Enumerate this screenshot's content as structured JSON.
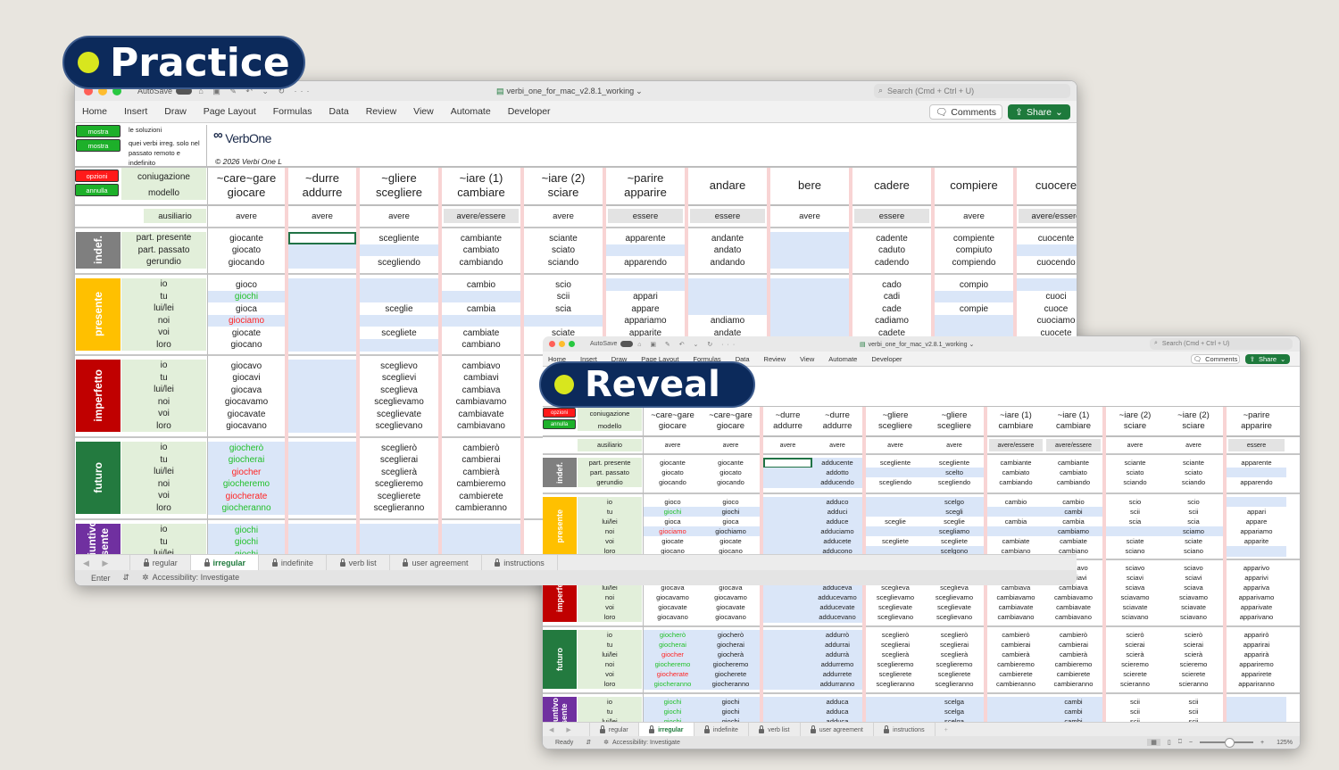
{
  "colors": {
    "input": "#dae6f8",
    "label_bg": "#e2efda",
    "separator": "#f8d4d4",
    "aux_gray": "#e3e3e3",
    "correct": "#22c02a",
    "wrong": "#ff2424",
    "badge": "#0c2a5b",
    "badge_dot": "#d8e61e",
    "excel_green": "#1e7a3c"
  },
  "badges": {
    "practice": "Practice",
    "reveal": "Reveal"
  },
  "app": {
    "autosave": "AutoSave",
    "file_title": "verbi_one_for_mac_v2.8.1_working",
    "search_placeholder": "Search (Cmd + Ctrl + U)",
    "ribbon_tabs": [
      "Home",
      "Insert",
      "Draw",
      "Page Layout",
      "Formulas",
      "Data",
      "Review",
      "View",
      "Automate",
      "Developer"
    ],
    "comments": "Comments",
    "share": "Share",
    "sheet_tabs": [
      {
        "label": "regular",
        "active": false
      },
      {
        "label": "irregular",
        "active": true
      },
      {
        "label": "indefinite",
        "active": false
      },
      {
        "label": "verb list",
        "active": false
      },
      {
        "label": "user agreement",
        "active": false
      },
      {
        "label": "instructions",
        "active": false
      }
    ],
    "add_sheet": "+",
    "accessibility": "Accessibility: Investigate",
    "zoom_level": "125%"
  },
  "practice_status": "Enter",
  "reveal_status": "Ready",
  "controls": {
    "mostra_1": "mostra",
    "mostra_1_label": "le soluzioni",
    "mostra_2": "mostra",
    "mostra_2_label": "quei verbi irreg. solo nel passato remoto e indefinito",
    "logo": "VerbOne",
    "copyright": "© 2026 Verbi One L",
    "opzioni": "opzioni",
    "annulla": "annulla",
    "coniugazione": "coniugazione",
    "modello": "modello",
    "ausiliario": "ausiliario"
  },
  "tenses": [
    {
      "key": "indef",
      "name": "indef.",
      "color": "#7f7f7f"
    },
    {
      "key": "pres",
      "name": "presente",
      "color": "#ffc000"
    },
    {
      "key": "imp",
      "name": "imperfetto",
      "color": "#c00000"
    },
    {
      "key": "fut",
      "name": "futuro",
      "color": "#237a3f"
    },
    {
      "key": "cong",
      "name": "congiuntivo presente",
      "color": "#7030a0"
    }
  ],
  "row_labels": {
    "indef": [
      "part. presente",
      "part. passato",
      "gerundio"
    ],
    "persons": [
      "io",
      "tu",
      "lui/lei",
      "noi",
      "voi",
      "loro"
    ]
  },
  "practice_columns": [
    {
      "h": [
        "~care~gare",
        "giocare"
      ],
      "aux": "avere",
      "indef": [
        "giocante",
        "giocato",
        "giocando"
      ],
      "pres": [
        "gioco",
        {
          "v": "giochi",
          "s": "ok"
        },
        "gioca",
        {
          "v": "giociamo",
          "s": "bad"
        },
        "giocate",
        "giocano"
      ],
      "imp": [
        "giocavo",
        "giocavi",
        "giocava",
        "giocavamo",
        "giocavate",
        "giocavano"
      ],
      "fut": [
        {
          "v": "giocherò",
          "s": "ok"
        },
        {
          "v": "giocherai",
          "s": "ok"
        },
        {
          "v": "giocher",
          "s": "bad"
        },
        {
          "v": "giocheremo",
          "s": "ok"
        },
        {
          "v": "giocherate",
          "s": "bad"
        },
        {
          "v": "giocheranno",
          "s": "ok"
        }
      ],
      "cong": [
        {
          "v": "giochi",
          "s": "ok"
        },
        {
          "v": "giochi",
          "s": "ok"
        },
        {
          "v": "giochi",
          "s": "ok"
        }
      ]
    },
    {
      "h": [
        "~durre",
        "addurre"
      ],
      "aux": "avere",
      "indef": [
        {
          "s": "sel"
        },
        null,
        null
      ],
      "pres": [
        null,
        null,
        null,
        null,
        null,
        null
      ],
      "imp": [
        null,
        null,
        null,
        null,
        null,
        null
      ],
      "fut": [
        null,
        null,
        null,
        null,
        null,
        null
      ],
      "cong": [
        null,
        null,
        null
      ]
    },
    {
      "h": [
        "~gliere",
        "scegliere"
      ],
      "aux": "avere",
      "indef": [
        "scegliente",
        null,
        "scegliendo"
      ],
      "pres": [
        null,
        null,
        "sceglie",
        null,
        "scegliete",
        null
      ],
      "imp": [
        "sceglievo",
        "sceglievi",
        "sceglieva",
        "sceglievamo",
        "sceglievate",
        "sceglievano"
      ],
      "fut": [
        "sceglierò",
        "sceglierai",
        "sceglierà",
        "sceglieremo",
        "sceglierete",
        "sceglieranno"
      ],
      "cong": [
        null,
        null,
        null
      ]
    },
    {
      "h": [
        "~iare (1)",
        "cambiare"
      ],
      "aux": "avere/essere",
      "aux_gray": true,
      "indef": [
        "cambiante",
        "cambiato",
        "cambiando"
      ],
      "pres": [
        "cambio",
        null,
        "cambia",
        null,
        "cambiate",
        "cambiano"
      ],
      "imp": [
        "cambiavo",
        "cambiavi",
        "cambiava",
        "cambiavamo",
        "cambiavate",
        "cambiavano"
      ],
      "fut": [
        "cambierò",
        "cambierai",
        "cambierà",
        "cambieremo",
        "cambierete",
        "cambieranno"
      ],
      "cong": [
        null,
        null,
        null
      ]
    },
    {
      "h": [
        "~iare (2)",
        "sciare"
      ],
      "aux": "avere",
      "indef": [
        "sciante",
        "sciato",
        "sciando"
      ],
      "pres": [
        "scio",
        "scii",
        "scia",
        null,
        "sciate"
      ]
    },
    {
      "h": [
        "~parire",
        "apparire"
      ],
      "aux": "essere",
      "aux_gray": true,
      "indef": [
        "apparente",
        null,
        "apparendo"
      ],
      "pres": [
        null,
        "appari",
        "appare",
        "appariamo",
        "apparite"
      ]
    },
    {
      "h": [
        "",
        "andare"
      ],
      "aux": "essere",
      "aux_gray": true,
      "indef": [
        "andante",
        "andato",
        "andando"
      ],
      "pres": [
        null,
        null,
        null,
        "andiamo",
        "andate"
      ]
    },
    {
      "h": [
        "",
        "bere"
      ],
      "aux": "avere",
      "indef": [
        null,
        null,
        null
      ],
      "pres": [
        null,
        null,
        null,
        null,
        null
      ]
    },
    {
      "h": [
        "",
        "cadere"
      ],
      "aux": "essere",
      "aux_gray": true,
      "indef": [
        "cadente",
        "caduto",
        "cadendo"
      ],
      "pres": [
        "cado",
        "cadi",
        "cade",
        "cadiamo",
        "cadete"
      ]
    },
    {
      "h": [
        "",
        "compiere"
      ],
      "aux": "avere",
      "indef": [
        "compiente",
        "compiuto",
        "compiendo"
      ],
      "pres": [
        "compio",
        null,
        "compie",
        null,
        null
      ]
    },
    {
      "h": [
        "",
        "cuocere"
      ],
      "aux": "avere/essere",
      "aux_gray": true,
      "indef": [
        "cuocente",
        null,
        "cuocendo"
      ],
      "pres": [
        null,
        "cuoci",
        "cuoce",
        "cuociamo",
        "cuocete"
      ]
    }
  ],
  "reveal_columns": [
    {
      "h": [
        "~care~gare",
        "giocare"
      ],
      "aux": "avere",
      "indef": [
        "giocante",
        "giocato",
        "giocando"
      ],
      "pres": [
        "gioco",
        {
          "v": "giochi",
          "s": "ok"
        },
        "gioca",
        {
          "v": "giociamo",
          "s": "bad"
        },
        "giocate",
        "giocano"
      ],
      "imp": [
        "giocavo",
        "giocavi",
        "giocava",
        "giocavamo",
        "giocavate",
        "giocavano"
      ],
      "fut": [
        {
          "v": "giocherò",
          "s": "ok"
        },
        {
          "v": "giocherai",
          "s": "ok"
        },
        {
          "v": "giocher",
          "s": "bad"
        },
        {
          "v": "giocheremo",
          "s": "ok"
        },
        {
          "v": "giocherate",
          "s": "bad"
        },
        {
          "v": "giocheranno",
          "s": "ok"
        }
      ],
      "cong": [
        {
          "v": "giochi",
          "s": "ok"
        },
        {
          "v": "giochi",
          "s": "ok"
        },
        {
          "v": "giochi",
          "s": "ok"
        }
      ]
    },
    {
      "h": [
        "~care~gare",
        "giocare"
      ],
      "aux": "avere",
      "indef": [
        "giocante",
        "giocato",
        "giocando"
      ],
      "pres": [
        "gioco",
        {
          "v": "giochi",
          "s": "in"
        },
        "gioca",
        {
          "v": "giochiamo",
          "s": "in"
        },
        "giocate",
        "giocano"
      ],
      "imp": [
        "giocavo",
        "giocavi",
        "giocava",
        "giocavamo",
        "giocavate",
        "giocavano"
      ],
      "fut": [
        {
          "v": "giocherò",
          "s": "in"
        },
        {
          "v": "giocherai",
          "s": "in"
        },
        {
          "v": "giocherà",
          "s": "in"
        },
        {
          "v": "giocheremo",
          "s": "in"
        },
        {
          "v": "giocherete",
          "s": "in"
        },
        {
          "v": "giocheranno",
          "s": "in"
        }
      ],
      "cong": [
        {
          "v": "giochi",
          "s": "in"
        },
        {
          "v": "giochi",
          "s": "in"
        },
        {
          "v": "giochi",
          "s": "in"
        }
      ]
    },
    {
      "h": [
        "~durre",
        "addurre"
      ],
      "aux": "avere",
      "indef": [
        {
          "s": "sel"
        },
        null,
        null
      ],
      "pres": [
        null,
        null,
        null,
        null,
        null,
        null
      ],
      "imp": [
        null,
        null,
        null,
        null,
        null,
        null
      ],
      "fut": [
        null,
        null,
        null,
        null,
        null,
        null
      ],
      "cong": [
        null,
        null,
        null
      ]
    },
    {
      "h": [
        "~durre",
        "addurre"
      ],
      "aux": "avere",
      "indef": [
        {
          "v": "adducente",
          "s": "in"
        },
        {
          "v": "addotto",
          "s": "in"
        },
        {
          "v": "adducendo",
          "s": "in"
        }
      ],
      "pres": [
        {
          "v": "adduco",
          "s": "in"
        },
        {
          "v": "adduci",
          "s": "in"
        },
        {
          "v": "adduce",
          "s": "in"
        },
        {
          "v": "adduciamo",
          "s": "in"
        },
        {
          "v": "adducete",
          "s": "in"
        },
        {
          "v": "adducono",
          "s": "in"
        }
      ],
      "imp": [
        {
          "v": "adducevo",
          "s": "in"
        },
        {
          "v": "adducevi",
          "s": "in"
        },
        {
          "v": "adduceva",
          "s": "in"
        },
        {
          "v": "adducevamo",
          "s": "in"
        },
        {
          "v": "adducevate",
          "s": "in"
        },
        {
          "v": "adducevano",
          "s": "in"
        }
      ],
      "fut": [
        {
          "v": "addurrò",
          "s": "in"
        },
        {
          "v": "addurrai",
          "s": "in"
        },
        {
          "v": "addurrà",
          "s": "in"
        },
        {
          "v": "addurremo",
          "s": "in"
        },
        {
          "v": "addurrete",
          "s": "in"
        },
        {
          "v": "addurranno",
          "s": "in"
        }
      ],
      "cong": [
        {
          "v": "adduca",
          "s": "in"
        },
        {
          "v": "adduca",
          "s": "in"
        },
        {
          "v": "adduca",
          "s": "in"
        }
      ]
    },
    {
      "h": [
        "~gliere",
        "scegliere"
      ],
      "aux": "avere",
      "indef": [
        "scegliente",
        null,
        "scegliendo"
      ],
      "pres": [
        null,
        null,
        "sceglie",
        null,
        "scegliete",
        null
      ],
      "imp": [
        "sceglievo",
        "sceglievi",
        "sceglieva",
        "sceglievamo",
        "sceglievate",
        "sceglievano"
      ],
      "fut": [
        "sceglierò",
        "sceglierai",
        "sceglierà",
        "sceglieremo",
        "sceglierete",
        "sceglieranno"
      ],
      "cong": [
        null,
        null,
        null
      ]
    },
    {
      "h": [
        "~gliere",
        "scegliere"
      ],
      "aux": "avere",
      "indef": [
        "scegliente",
        {
          "v": "scelto",
          "s": "in"
        },
        "scegliendo"
      ],
      "pres": [
        {
          "v": "scelgo",
          "s": "in"
        },
        {
          "v": "scegli",
          "s": "in"
        },
        "sceglie",
        {
          "v": "scegliamo",
          "s": "in"
        },
        "scegliete",
        {
          "v": "scelgono",
          "s": "in"
        }
      ],
      "imp": [
        "sceglievo",
        "sceglievi",
        "sceglieva",
        "sceglievamo",
        "sceglievate",
        "sceglievano"
      ],
      "fut": [
        "sceglierò",
        "sceglierai",
        "sceglierà",
        "sceglieremo",
        "sceglierete",
        "sceglieranno"
      ],
      "cong": [
        {
          "v": "scelga",
          "s": "in"
        },
        {
          "v": "scelga",
          "s": "in"
        },
        {
          "v": "scelga",
          "s": "in"
        }
      ]
    },
    {
      "h": [
        "~iare (1)",
        "cambiare"
      ],
      "aux": "avere/essere",
      "aux_gray": true,
      "indef": [
        "cambiante",
        "cambiato",
        "cambiando"
      ],
      "pres": [
        "cambio",
        null,
        "cambia",
        null,
        "cambiate",
        "cambiano"
      ],
      "imp": [
        "cambiavo",
        "cambiavi",
        "cambiava",
        "cambiavamo",
        "cambiavate",
        "cambiavano"
      ],
      "fut": [
        "cambierò",
        "cambierai",
        "cambierà",
        "cambieremo",
        "cambierete",
        "cambieranno"
      ],
      "cong": [
        null,
        null,
        null
      ]
    },
    {
      "h": [
        "~iare (1)",
        "cambiare"
      ],
      "aux": "avere/essere",
      "aux_gray": true,
      "indef": [
        "cambiante",
        "cambiato",
        "cambiando"
      ],
      "pres": [
        "cambio",
        {
          "v": "cambi",
          "s": "in"
        },
        "cambia",
        {
          "v": "cambiamo",
          "s": "in"
        },
        "cambiate",
        "cambiano"
      ],
      "imp": [
        "cambiavo",
        "cambiavi",
        "cambiava",
        "cambiavamo",
        "cambiavate",
        "cambiavano"
      ],
      "fut": [
        "cambierò",
        "cambierai",
        "cambierà",
        "cambieremo",
        "cambierete",
        "cambieranno"
      ],
      "cong": [
        {
          "v": "cambi",
          "s": "in"
        },
        {
          "v": "cambi",
          "s": "in"
        },
        {
          "v": "cambi",
          "s": "in"
        }
      ]
    },
    {
      "h": [
        "~iare (2)",
        "sciare"
      ],
      "aux": "avere",
      "indef": [
        "sciante",
        "sciato",
        "sciando"
      ],
      "pres": [
        "scio",
        "scii",
        "scia",
        null,
        "sciate",
        "sciano"
      ],
      "imp": [
        "sciavo",
        "sciavi",
        "sciava",
        "sciavamo",
        "sciavate",
        "sciavano"
      ],
      "fut": [
        "scierò",
        "scierai",
        "scierà",
        "scieremo",
        "scierete",
        "scieranno"
      ],
      "cong": [
        "scii",
        "scii",
        "scii"
      ]
    },
    {
      "h": [
        "~iare (2)",
        "sciare"
      ],
      "aux": "avere",
      "indef": [
        "sciante",
        "sciato",
        "sciando"
      ],
      "pres": [
        "scio",
        "scii",
        "scia",
        {
          "v": "sciamo",
          "s": "in"
        },
        "sciate",
        "sciano"
      ],
      "imp": [
        "sciavo",
        "sciavi",
        "sciava",
        "sciavamo",
        "sciavate",
        "sciavano"
      ],
      "fut": [
        "scierò",
        "scierai",
        "scierà",
        "scieremo",
        "scierete",
        "scieranno"
      ],
      "cong": [
        "scii",
        "scii",
        "scii"
      ]
    },
    {
      "h": [
        "~parire",
        "apparire"
      ],
      "aux": "essere",
      "aux_gray": true,
      "indef": [
        "apparente",
        null,
        "apparendo"
      ],
      "pres": [
        null,
        "appari",
        "appare",
        "appariamo",
        "apparite",
        null
      ],
      "imp": [
        "apparivo",
        "apparivi",
        "appariva",
        "apparivamo",
        "apparivate",
        "apparivano"
      ],
      "fut": [
        "apparirò",
        "apparirai",
        "apparirà",
        "appariremo",
        "apparirete",
        "appariranno"
      ],
      "cong": [
        null,
        null,
        null
      ]
    }
  ]
}
